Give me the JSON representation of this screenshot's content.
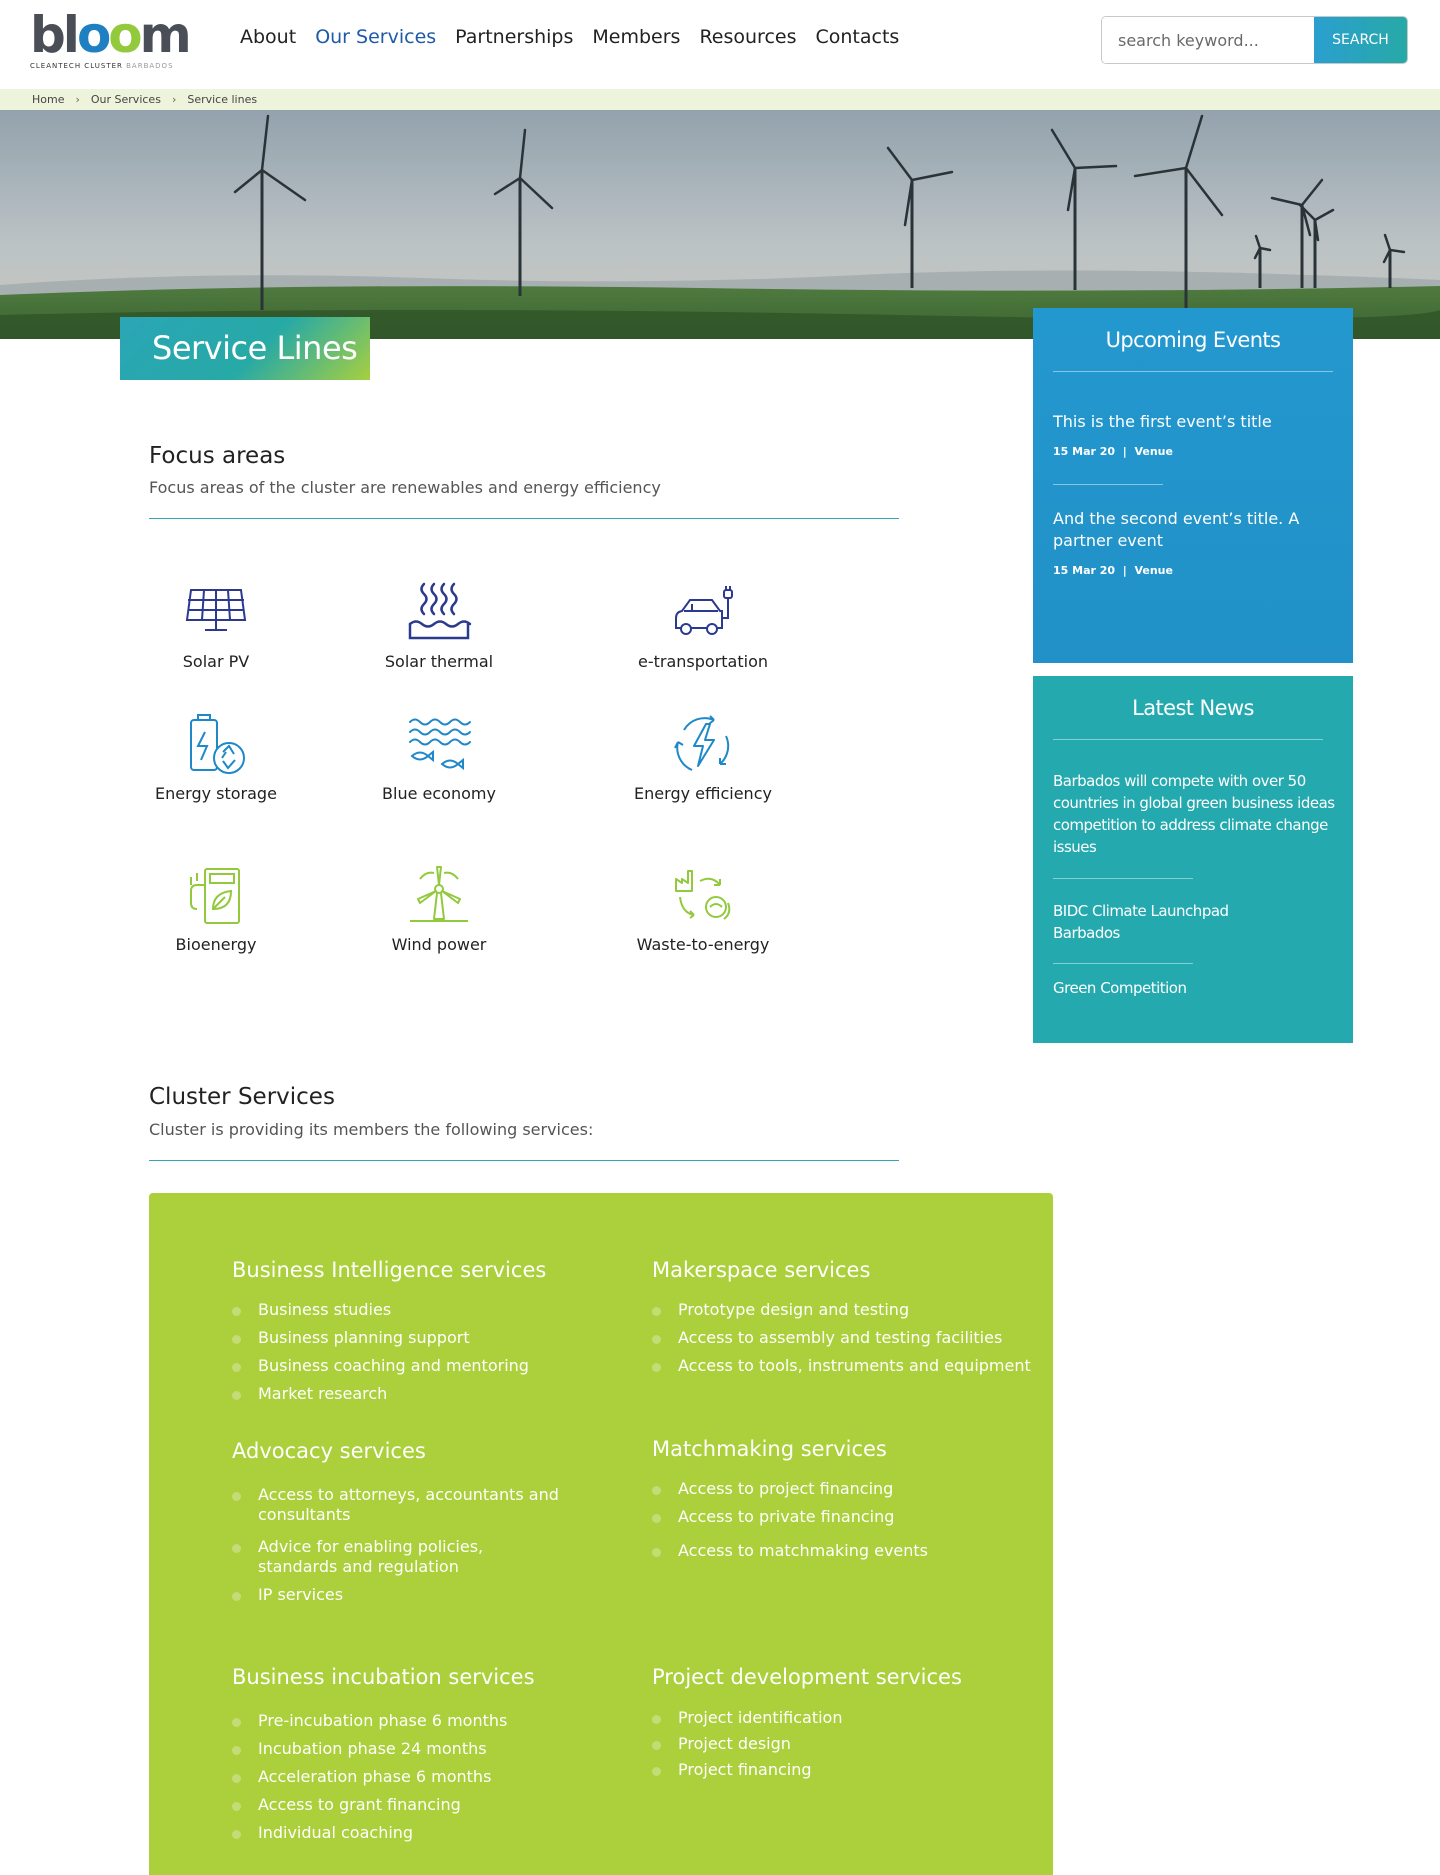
{
  "brand": {
    "logo_word": [
      "bl",
      "o",
      "o",
      "m"
    ],
    "logo_tagline": "CLEANTECH CLUSTER",
    "logo_tagline_location": "BARBADOS",
    "accent_blue": "#1e7fc1",
    "accent_green": "#93c93d",
    "teal": "#27a9a6"
  },
  "nav": {
    "items": [
      {
        "label": "About",
        "active": false
      },
      {
        "label": "Our Services",
        "active": true
      },
      {
        "label": "Partnerships",
        "active": false
      },
      {
        "label": "Members",
        "active": false
      },
      {
        "label": "Resources",
        "active": false
      },
      {
        "label": "Contacts",
        "active": false
      }
    ]
  },
  "search": {
    "placeholder": "search keyword...",
    "button_label": "SEARCH"
  },
  "breadcrumb": [
    "Home",
    "Our Services",
    "Service lines"
  ],
  "breadcrumb_separator": "›",
  "page_title": "Service Lines",
  "focus": {
    "title": "Focus areas",
    "subtitle": "Focus areas of the cluster are renewables and energy efficiency",
    "items": [
      {
        "label": "Solar PV",
        "icon": "solar-panel-icon",
        "color": "#2b3a8f"
      },
      {
        "label": "Solar thermal",
        "icon": "solar-thermal-icon",
        "color": "#2b3a8f"
      },
      {
        "label": "e-transportation",
        "icon": "electric-car-icon",
        "color": "#2b3a8f"
      },
      {
        "label": "Energy storage",
        "icon": "battery-recycle-icon",
        "color": "#1e88c8"
      },
      {
        "label": "Blue economy",
        "icon": "waves-fish-icon",
        "color": "#1e88c8"
      },
      {
        "label": "Energy efficiency",
        "icon": "lightning-cycle-icon",
        "color": "#1e88c8"
      },
      {
        "label": "Bioenergy",
        "icon": "bio-fuel-pump-icon",
        "color": "#93c93d"
      },
      {
        "label": "Wind power",
        "icon": "wind-turbine-icon",
        "color": "#93c93d"
      },
      {
        "label": "Waste-to-energy",
        "icon": "factory-bio-icon",
        "color": "#93c93d"
      }
    ]
  },
  "events": {
    "title": "Upcoming Events",
    "items": [
      {
        "title": "This is the first event’s title",
        "date": "15 Mar 20",
        "sep": "|",
        "venue": "Venue"
      },
      {
        "title": "And the second event’s  title. A partner event",
        "date": "15 Mar 20",
        "sep": "|",
        "venue": "Venue"
      }
    ]
  },
  "news": {
    "title": "Latest News",
    "items": [
      "Barbados will compete with over 50 countries in global green business ideas competition to address climate change issues",
      "BIDC Climate Launchpad Barbados",
      "Green Competition"
    ]
  },
  "cluster": {
    "title": "Cluster Services",
    "subtitle": "Cluster is providing its members the following services:",
    "box_color": "#abd03b",
    "groups": [
      {
        "title": "Business Intelligence services",
        "items": [
          "Business studies",
          "Business planning support",
          "Business coaching and mentoring",
          "Market research"
        ]
      },
      {
        "title": "Makerspace services",
        "items": [
          "Prototype design and testing",
          "Access to assembly and testing facilities",
          "Access to tools, instruments and equipment"
        ]
      },
      {
        "title": "Advocacy services",
        "items": [
          "Access to attorneys, accountants and consultants",
          "Advice for enabling policies, standards and regulation",
          "IP services"
        ]
      },
      {
        "title": "Matchmaking services",
        "items": [
          "Access to project financing",
          "Access to private financing",
          "Access to matchmaking events"
        ]
      },
      {
        "title": "Business incubation services",
        "items": [
          "Pre-incubation phase 6 months",
          "Incubation phase 24 months",
          "Acceleration phase 6 months",
          "Access to grant financing",
          "Individual coaching"
        ]
      },
      {
        "title": "Project development services",
        "items": [
          "Project identification",
          "Project design",
          "Project financing"
        ]
      }
    ]
  }
}
